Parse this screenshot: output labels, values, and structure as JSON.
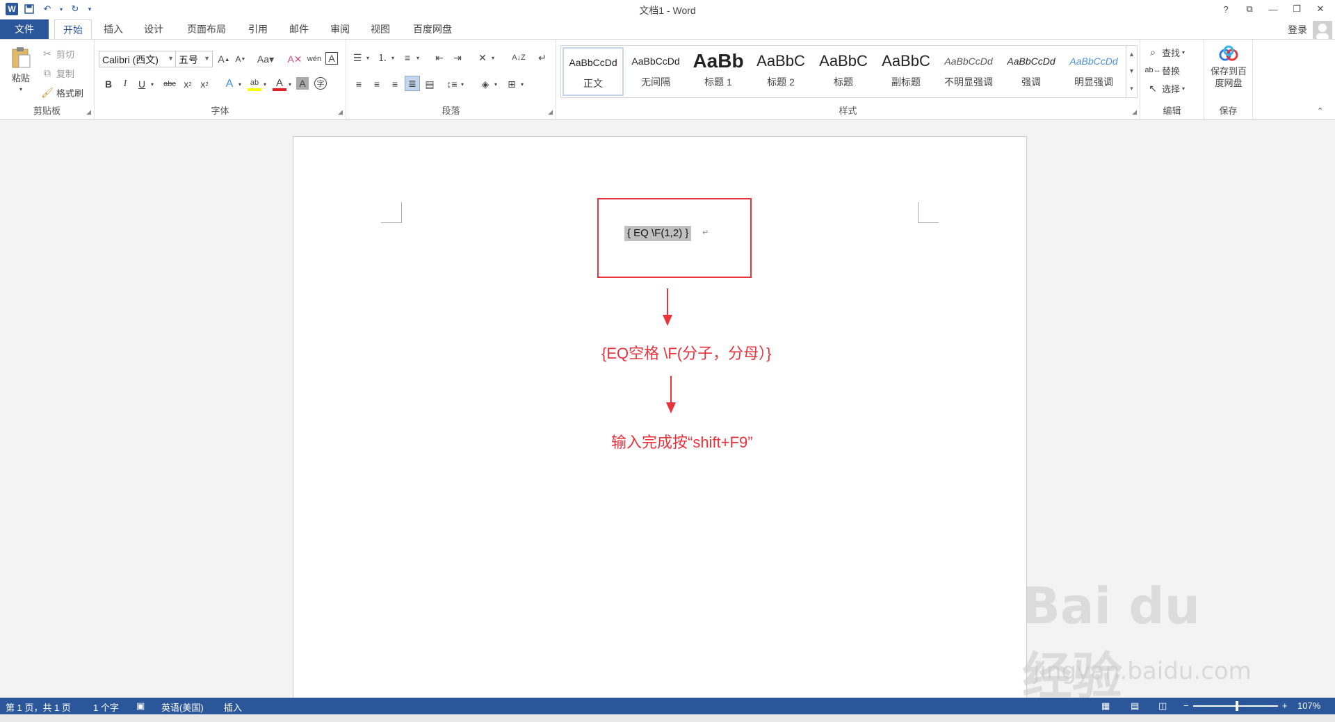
{
  "app": {
    "title": "文档1 - Word"
  },
  "qat": {
    "save_icon": "save-icon",
    "undo_icon": "undo-icon",
    "redo_icon": "redo-icon"
  },
  "window": {
    "help": "?",
    "ribbon_display": "⧉",
    "minimize": "—",
    "restore": "❐",
    "close": "✕"
  },
  "tabs": [
    "文件",
    "开始",
    "插入",
    "设计",
    "页面布局",
    "引用",
    "邮件",
    "审阅",
    "视图",
    "百度网盘"
  ],
  "account": {
    "login": "登录"
  },
  "clipboard": {
    "paste": "粘贴",
    "cut": "剪切",
    "copy": "复制",
    "format_painter": "格式刷",
    "label": "剪贴板"
  },
  "font": {
    "name": "Calibri (西文)",
    "size": "五号",
    "label": "字体"
  },
  "paragraph": {
    "label": "段落"
  },
  "styles": {
    "label": "样式",
    "items": [
      {
        "sample": "AaBbCcDd",
        "name": "正文"
      },
      {
        "sample": "AaBbCcDd",
        "name": "无间隔"
      },
      {
        "sample": "AaBb",
        "name": "标题 1"
      },
      {
        "sample": "AaBbC",
        "name": "标题 2"
      },
      {
        "sample": "AaBbC",
        "name": "标题"
      },
      {
        "sample": "AaBbC",
        "name": "副标题"
      },
      {
        "sample": "AaBbCcDd",
        "name": "不明显强调"
      },
      {
        "sample": "AaBbCcDd",
        "name": "强调"
      },
      {
        "sample": "AaBbCcDd",
        "name": "明显强调"
      }
    ]
  },
  "editing": {
    "find": "查找",
    "replace": "替换",
    "select": "选择",
    "label": "编辑"
  },
  "save_group": {
    "button": "保存到百度网盘",
    "label": "保存"
  },
  "document": {
    "field_code": "{  EQ \\F(1,2)  }",
    "annotation1": "{EQ空格 \\F(分子，分母）}",
    "annotation2": "输入完成按“shift+F9”"
  },
  "watermark": {
    "logo": "Bai du 经验",
    "url": "jingyan.baidu.com"
  },
  "status": {
    "page": "第 1 页，共 1 页",
    "words": "1 个字",
    "language": "英语(美国)",
    "mode": "插入",
    "zoom": "107%"
  },
  "colors": {
    "accent": "#2b579a",
    "annotation": "#e8323c"
  }
}
